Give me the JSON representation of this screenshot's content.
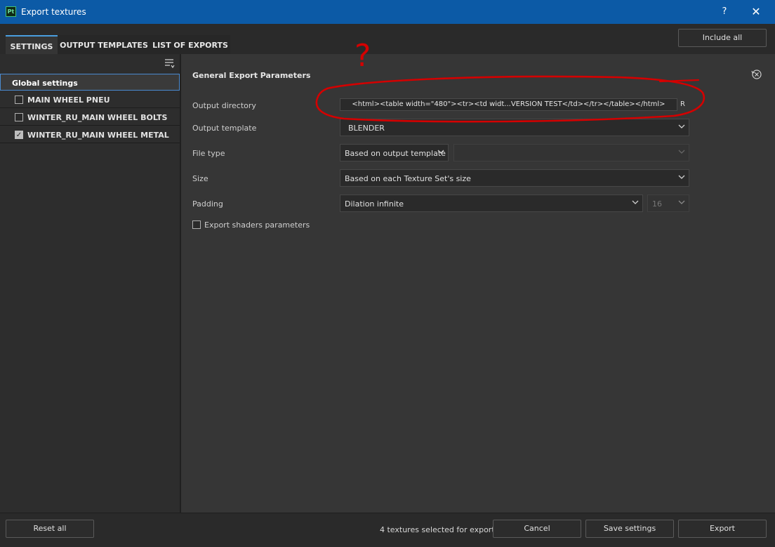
{
  "window": {
    "app_icon_text": "Pt",
    "title": "Export textures",
    "help_label": "?",
    "close_label": "✕"
  },
  "tabs": [
    {
      "label": "SETTINGS",
      "active": true
    },
    {
      "label": "OUTPUT TEMPLATES",
      "active": false
    },
    {
      "label": "LIST OF EXPORTS",
      "active": false
    }
  ],
  "toolbar": {
    "include_all_label": "Include all"
  },
  "sidebar": {
    "items": [
      {
        "label": "Global settings",
        "selected": true
      },
      {
        "label": "MAIN WHEEL PNEU",
        "checked": false
      },
      {
        "label": "WINTER_RU_MAIN WHEEL BOLTS",
        "checked": false
      },
      {
        "label": "WINTER_RU_MAIN WHEEL METAL",
        "checked": true
      }
    ]
  },
  "main": {
    "section_title": "General Export Parameters",
    "output_directory": {
      "label": "Output directory",
      "value": "<html><table width=\"480\"><tr><td widt...VERSION TEST</td></tr></table></html>",
      "trailing": "R"
    },
    "output_template": {
      "label": "Output template",
      "value": "BLENDER"
    },
    "file_type": {
      "label": "File type",
      "value": "Based on output template",
      "secondary_value": ""
    },
    "size": {
      "label": "Size",
      "value": "Based on each Texture Set's size"
    },
    "padding": {
      "label": "Padding",
      "value": "Dilation infinite",
      "secondary_value": "16"
    },
    "export_shaders": {
      "label": "Export shaders parameters",
      "checked": false
    }
  },
  "annotation": {
    "text": "?",
    "color": "#d40000"
  },
  "footer": {
    "reset_all_label": "Reset all",
    "status": "4 textures selected for export",
    "cancel_label": "Cancel",
    "save_settings_label": "Save settings",
    "export_label": "Export"
  },
  "colors": {
    "titlebar": "#0c5aa6",
    "accent": "#4a9ee0",
    "background": "#363636"
  }
}
